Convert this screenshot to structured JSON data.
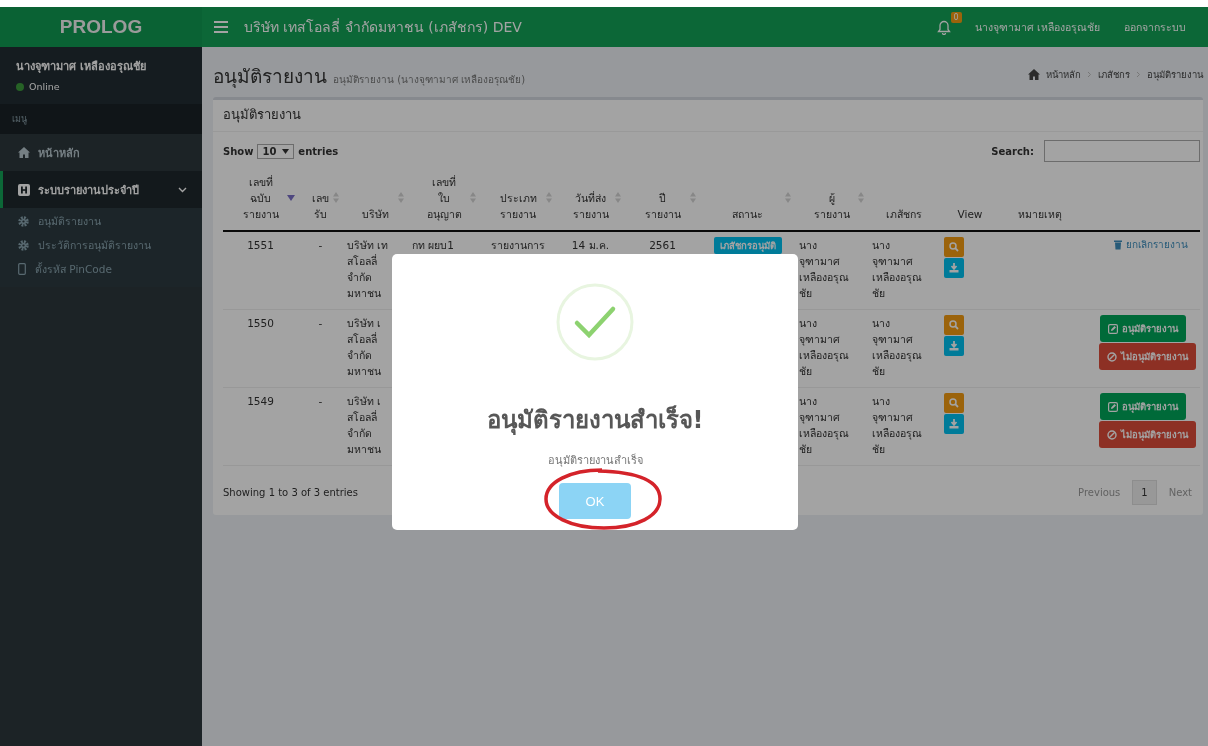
{
  "header": {
    "logo": "PROLOG",
    "company": "บริษัท เทสโอลลี่ จำกัดมหาชน (เภสัชกร) DEV",
    "notification_count": "0",
    "user": "นางจุฑามาศ เหลืองอรุณชัย",
    "logout": "ออกจากระบบ"
  },
  "sidebar": {
    "user_name": "นางจุฑามาศ เหลืองอรุณชัย",
    "status": "Online",
    "section_label": "เมนู",
    "items": [
      {
        "label": "หน้าหลัก",
        "selected": false
      },
      {
        "label": "ระบบรายงานประจำปี",
        "selected": true,
        "expanded": true,
        "children": [
          {
            "label": "อนุมัติรายงาน"
          },
          {
            "label": "ประวัติการอนุมัติรายงาน"
          },
          {
            "label": "ตั้งรหัส PinCode"
          }
        ]
      }
    ]
  },
  "page": {
    "title": "อนุมัติรายงาน",
    "subtitle": "อนุมัติรายงาน (นางจุฑามาศ เหลืองอรุณชัย)",
    "breadcrumb": [
      "หน้าหลัก",
      "เภสัชกร",
      "อนุมัติรายงาน"
    ]
  },
  "box": {
    "title": "อนุมัติรายงาน",
    "show_label": "Show",
    "page_size": "10",
    "entries_label": "entries",
    "search_label": "Search:",
    "columns": [
      {
        "label": "เลขที่\nฉบับ\nรายงาน",
        "sorted": true
      },
      {
        "label": "เลข\nรับ",
        "sorted": false
      },
      {
        "label": "บริษัท",
        "sorted": false
      },
      {
        "label": "เลขที่\nใบ\nอนุญาต",
        "sorted": false
      },
      {
        "label": "ประเภท\nรายงาน",
        "sorted": false
      },
      {
        "label": "วันที่ส่ง\nรายงาน",
        "sorted": false
      },
      {
        "label": "ปี\nรายงาน",
        "sorted": false
      },
      {
        "label": "สถานะ",
        "sorted": false
      },
      {
        "label": "ผู้\nรายงาน",
        "sorted": false
      },
      {
        "label": "เภสัชกร"
      },
      {
        "label": "View"
      },
      {
        "label": "หมายเหตุ"
      }
    ],
    "rows": [
      {
        "number": "1551",
        "receipt": "-",
        "company": "บริษัท เท\nสโอลลี่\nจำกัด\nมหาชน",
        "license": "กท ผยบ1",
        "type": "รายงานการ",
        "date": "14 ม.ค.",
        "year": "2561",
        "status": "เภสัชกรอนุมัติ",
        "reporter": "นาง\nจุฑามาศ\nเหลืองอรุณ\nชัย",
        "pharmacist": "นาง\nจุฑามาศ\nเหลืองอรุณ\nชัย",
        "actions": [
          {
            "kind": "cancel",
            "label": "ยกเลิกรายงาน"
          }
        ]
      },
      {
        "number": "1550",
        "receipt": "-",
        "company": "บริษัท เ\nสโอลลี่\nจำกัด\nมหาชน",
        "reporter": "นาง\nจุฑามาศ\nเหลืองอรุณ\nชัย",
        "pharmacist": "นาง\nจุฑามาศ\nเหลืองอรุณ\nชัย",
        "actions": [
          {
            "kind": "approve",
            "label": "อนุมัติรายงาน"
          },
          {
            "kind": "reject",
            "label": "ไม่อนุมัติรายงาน"
          }
        ]
      },
      {
        "number": "1549",
        "receipt": "-",
        "company": "บริษัท เ\nสโอลลี่\nจำกัด\nมหาชน",
        "reporter": "นาง\nจุฑามาศ\nเหลืองอรุณ\nชัย",
        "pharmacist": "นาง\nจุฑามาศ\nเหลืองอรุณ\nชัย",
        "actions": [
          {
            "kind": "approve",
            "label": "อนุมัติรายงาน"
          },
          {
            "kind": "reject",
            "label": "ไม่อนุมัติรายงาน"
          }
        ]
      }
    ],
    "info": "Showing 1 to 3 of 3 entries",
    "pagination": {
      "previous": "Previous",
      "pages": [
        {
          "label": "1",
          "selected": true
        }
      ],
      "next": "Next"
    }
  },
  "modal": {
    "title": "อนุมัติรายงานสำเร็จ!",
    "text": "อนุมัติรายงานสำเร็จ",
    "confirm": "OK"
  }
}
